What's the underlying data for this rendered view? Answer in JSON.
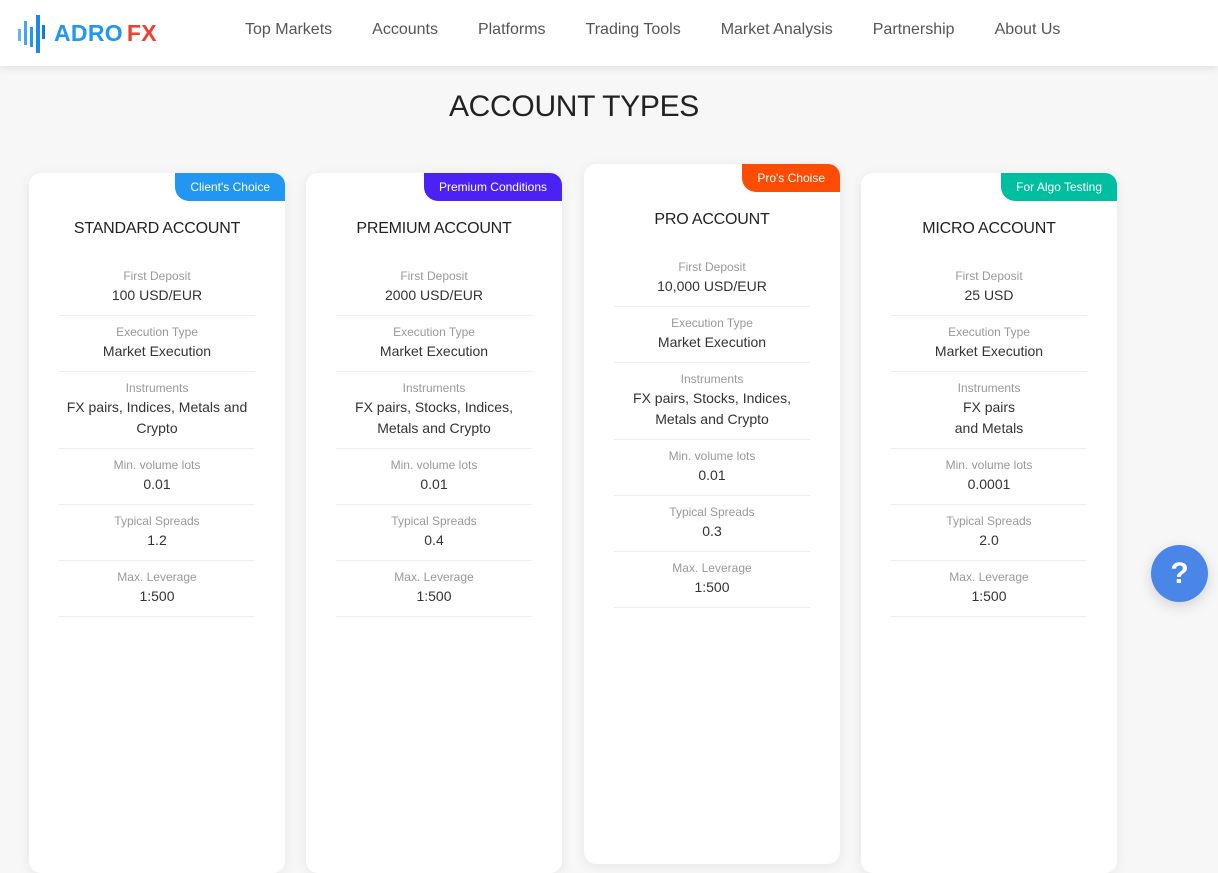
{
  "header": {
    "logo": {
      "text_primary": "ADRO",
      "text_accent": "FX",
      "icon": "bar-chart-logo-icon"
    },
    "nav": [
      {
        "label": "Top Markets"
      },
      {
        "label": "Accounts"
      },
      {
        "label": "Platforms"
      },
      {
        "label": "Trading Tools"
      },
      {
        "label": "Market Analysis"
      },
      {
        "label": "Partnership"
      },
      {
        "label": "About Us"
      }
    ]
  },
  "page": {
    "title": "ACCOUNT TYPES"
  },
  "colors": {
    "brand_blue": "#2196f3",
    "brand_red": "#f0402f",
    "badge_standard": "#2196f3",
    "badge_premium": "#4b22f4",
    "badge_pro": "#ff4c05",
    "badge_micro": "#00bfa0",
    "help_button": "#4a86e8"
  },
  "cards": [
    {
      "badge": "Client's Choice",
      "title": "STANDARD ACCOUNT",
      "rows": [
        {
          "label": "First Deposit",
          "value": "100 USD/EUR"
        },
        {
          "label": "Execution Type",
          "value": "Market Execution"
        },
        {
          "label": "Instruments",
          "value": "FX pairs, Indices, Metals and Crypto"
        },
        {
          "label": "Min. volume lots",
          "value": "0.01"
        },
        {
          "label": "Typical Spreads",
          "value": "1.2"
        },
        {
          "label": "Max. Leverage",
          "value": "1:500"
        }
      ]
    },
    {
      "badge": "Premium Conditions",
      "title": "PREMIUM ACCOUNT",
      "rows": [
        {
          "label": "First Deposit",
          "value": "2000 USD/EUR"
        },
        {
          "label": "Execution Type",
          "value": "Market Execution"
        },
        {
          "label": "Instruments",
          "value": "FX pairs, Stocks, Indices, Metals and Crypto"
        },
        {
          "label": "Min. volume lots",
          "value": "0.01"
        },
        {
          "label": "Typical Spreads",
          "value": "0.4"
        },
        {
          "label": "Max. Leverage",
          "value": "1:500"
        }
      ]
    },
    {
      "badge": "Pro's Choise",
      "title": "PRO ACCOUNT",
      "rows": [
        {
          "label": "First Deposit",
          "value": "10,000 USD/EUR"
        },
        {
          "label": "Execution Type",
          "value": "Market Execution"
        },
        {
          "label": "Instruments",
          "value": "FX pairs, Stocks, Indices, Metals and Crypto"
        },
        {
          "label": "Min. volume lots",
          "value": "0.01"
        },
        {
          "label": "Typical Spreads",
          "value": "0.3"
        },
        {
          "label": "Max. Leverage",
          "value": "1:500"
        }
      ]
    },
    {
      "badge": "For Algo Testing",
      "title": "MICRO ACCOUNT",
      "rows": [
        {
          "label": "First Deposit",
          "value": "25 USD"
        },
        {
          "label": "Execution Type",
          "value": "Market Execution"
        },
        {
          "label": "Instruments",
          "value": "FX pairs\nand Metals"
        },
        {
          "label": "Min. volume lots",
          "value": "0.0001"
        },
        {
          "label": "Typical Spreads",
          "value": "2.0"
        },
        {
          "label": "Max. Leverage",
          "value": "1:500"
        }
      ]
    }
  ],
  "help": {
    "icon": "question-mark-icon",
    "glyph": "?"
  }
}
